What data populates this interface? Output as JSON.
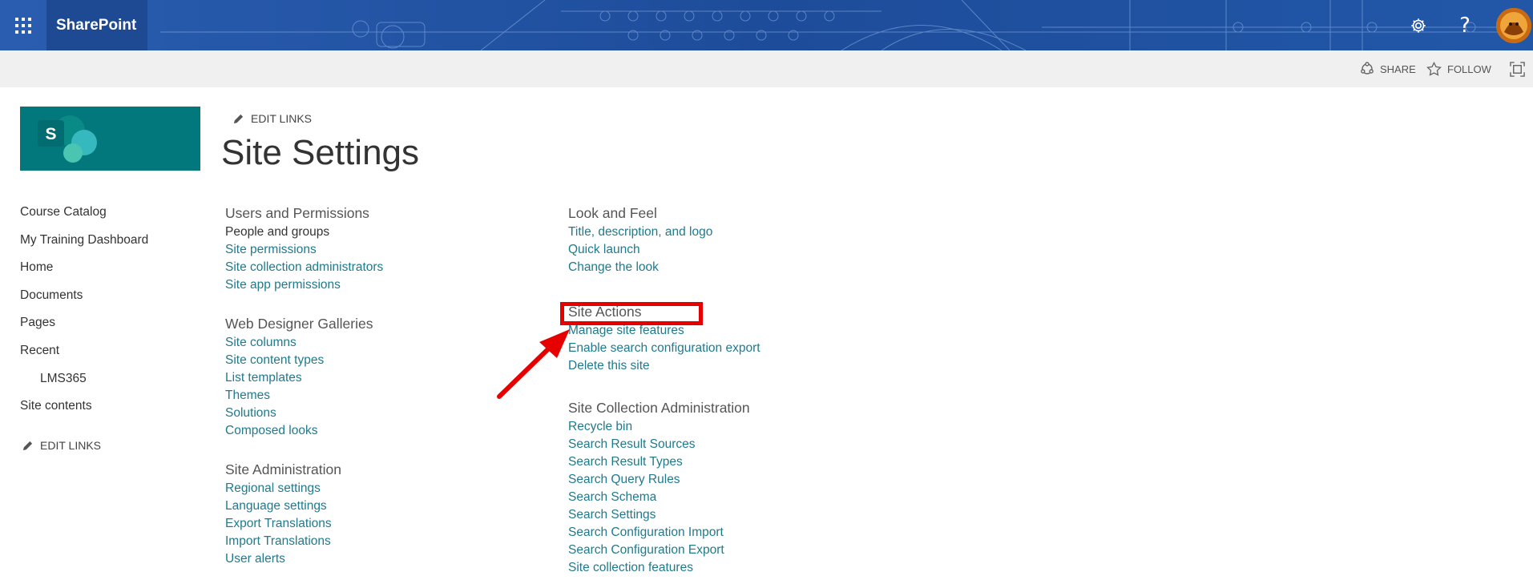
{
  "suitebar": {
    "app_name": "SharePoint",
    "waffle_icon": "waffle-icon",
    "settings_icon": "gear-icon",
    "help_label": "?",
    "avatar_icon": "avatar"
  },
  "actionbar": {
    "share_label": "SHARE",
    "follow_label": "FOLLOW",
    "focus_icon": "focus-mode-icon"
  },
  "header": {
    "edit_links_label": "EDIT LINKS",
    "page_title": "Site Settings",
    "logo_letter": "S"
  },
  "leftnav": {
    "items": [
      {
        "label": "Course Catalog"
      },
      {
        "label": "My Training Dashboard"
      },
      {
        "label": "Home"
      },
      {
        "label": "Documents"
      },
      {
        "label": "Pages"
      },
      {
        "label": "Recent"
      },
      {
        "label": "LMS365"
      },
      {
        "label": "Site contents"
      }
    ],
    "edit_links_label": "EDIT LINKS"
  },
  "sections": {
    "users_permissions": {
      "heading": "Users and Permissions",
      "links": [
        "People and groups",
        "Site permissions",
        "Site collection administrators",
        "Site app permissions"
      ]
    },
    "web_designer_galleries": {
      "heading": "Web Designer Galleries",
      "links": [
        "Site columns",
        "Site content types",
        "List templates",
        "Themes",
        "Solutions",
        "Composed looks"
      ]
    },
    "site_administration": {
      "heading": "Site Administration",
      "links": [
        "Regional settings",
        "Language settings",
        "Export Translations",
        "Import Translations",
        "User alerts"
      ]
    },
    "look_and_feel": {
      "heading": "Look and Feel",
      "links": [
        "Title, description, and logo",
        "Quick launch",
        "Change the look"
      ]
    },
    "site_actions": {
      "heading": "Site Actions",
      "links": [
        "Manage site features",
        "Enable search configuration export",
        "Delete this site"
      ]
    },
    "site_collection_administration": {
      "heading": "Site Collection Administration",
      "links": [
        "Recycle bin",
        "Search Result Sources",
        "Search Result Types",
        "Search Query Rules",
        "Search Schema",
        "Search Settings",
        "Search Configuration Import",
        "Search Configuration Export",
        "Site collection features"
      ]
    }
  },
  "colors": {
    "suitebar": "#1f4f9e",
    "link": "#1f7a8c",
    "logo_bg": "#03787c",
    "annotation": "#e60000"
  }
}
